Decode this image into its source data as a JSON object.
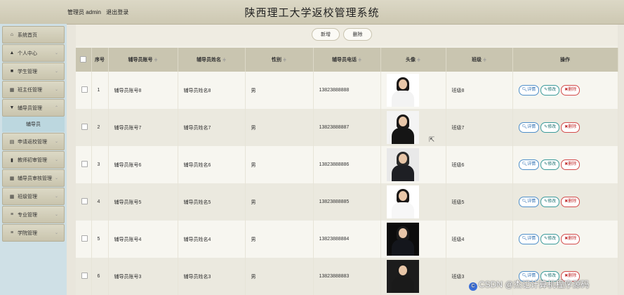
{
  "header": {
    "user_label": "管理员 admin",
    "logout_label": "退出登录",
    "title": "陕西理工大学返校管理系统"
  },
  "sidebar": {
    "items": [
      {
        "label": "系统首页",
        "icon": "home-icon",
        "glyph": "⌂"
      },
      {
        "label": "个人中心",
        "icon": "user-icon",
        "glyph": "▲",
        "chevron": "⌄"
      },
      {
        "label": "学生管理",
        "icon": "student-icon",
        "glyph": "■",
        "chevron": "⌄"
      },
      {
        "label": "班主任管理",
        "icon": "grid-icon",
        "glyph": "▦",
        "chevron": "⌄"
      },
      {
        "label": "辅导员管理",
        "icon": "shield-icon",
        "glyph": "▼",
        "chevron": "⌃"
      },
      {
        "label": "申请返校管理",
        "icon": "list-icon",
        "glyph": "▤",
        "chevron": "⌄"
      },
      {
        "label": "教师初审管理",
        "icon": "bar-chart-icon",
        "glyph": "▮",
        "chevron": "⌄"
      },
      {
        "label": "辅导员审核管理",
        "icon": "grid-icon",
        "glyph": "▦",
        "chevron": "⌄"
      },
      {
        "label": "班级管理",
        "icon": "grid-icon",
        "glyph": "▦",
        "chevron": "⌄"
      },
      {
        "label": "专业管理",
        "icon": "menu-icon",
        "glyph": "≡",
        "chevron": "⌄"
      },
      {
        "label": "学院管理",
        "icon": "menu-icon",
        "glyph": "≡",
        "chevron": "⌄"
      }
    ],
    "subitem_label": "辅导员"
  },
  "toolbar": {
    "add_label": "新增",
    "delete_label": "删除"
  },
  "table": {
    "columns": {
      "index": "序号",
      "account": "辅导员账号",
      "name": "辅导员姓名",
      "gender": "性别",
      "phone": "辅导员电话",
      "avatar": "头像",
      "class": "班级",
      "actions": "操作"
    },
    "sort_glyph": "≑",
    "rows": [
      {
        "index": "1",
        "account": "辅导员账号8",
        "name": "辅导员姓名8",
        "gender": "男",
        "phone": "13823888888",
        "class": "班级8",
        "photo": {
          "hair": "#1a1716",
          "outfit": "#f3f3f3",
          "bg": "#ffffff"
        }
      },
      {
        "index": "2",
        "account": "辅导员账号7",
        "name": "辅导员姓名7",
        "gender": "男",
        "phone": "13823888887",
        "class": "班级7",
        "photo": {
          "hair": "#1a1716",
          "outfit": "#151515",
          "bg": "#f4f4f4"
        }
      },
      {
        "index": "3",
        "account": "辅导员账号6",
        "name": "辅导员姓名6",
        "gender": "男",
        "phone": "13823888886",
        "class": "班级6",
        "photo": {
          "hair": "#2a2a2a",
          "outfit": "#1e1f24",
          "bg": "#e9e9e9"
        }
      },
      {
        "index": "4",
        "account": "辅导员账号5",
        "name": "辅导员姓名5",
        "gender": "男",
        "phone": "13823888885",
        "class": "班级5",
        "photo": {
          "hair": "#1a1716",
          "outfit": "#f7f7f7",
          "bg": "#ffffff"
        }
      },
      {
        "index": "5",
        "account": "辅导员账号4",
        "name": "辅导员姓名4",
        "gender": "男",
        "phone": "13823888884",
        "class": "班级4",
        "photo": {
          "hair": "#1b1b1b",
          "outfit": "#14161c",
          "bg": "#0c0c0c"
        }
      },
      {
        "index": "6",
        "account": "辅导员账号3",
        "name": "辅导员姓名3",
        "gender": "男",
        "phone": "13823888883",
        "class": "班级3",
        "photo": {
          "hair": "#1b1b1b",
          "outfit": "#1a1a1a",
          "bg": "#1c1c1c"
        }
      }
    ],
    "actions": {
      "detail_label": "详情",
      "edit_label": "修改",
      "delete_label": "删除",
      "detail_icon": "search-icon",
      "edit_icon": "pencil-icon",
      "delete_icon": "close-circle-icon"
    }
  },
  "watermark": {
    "text": "CSDN @杰记计算机程序源码",
    "badge": "C"
  },
  "colors": {
    "header_bg": "#d4d0bb",
    "sidebar_bg": "#cfe0e6",
    "table_header_bg": "#c9c5b0",
    "detail_blue": "#2b6cb0",
    "edit_teal": "#1f7373",
    "delete_red": "#c02a2a"
  }
}
